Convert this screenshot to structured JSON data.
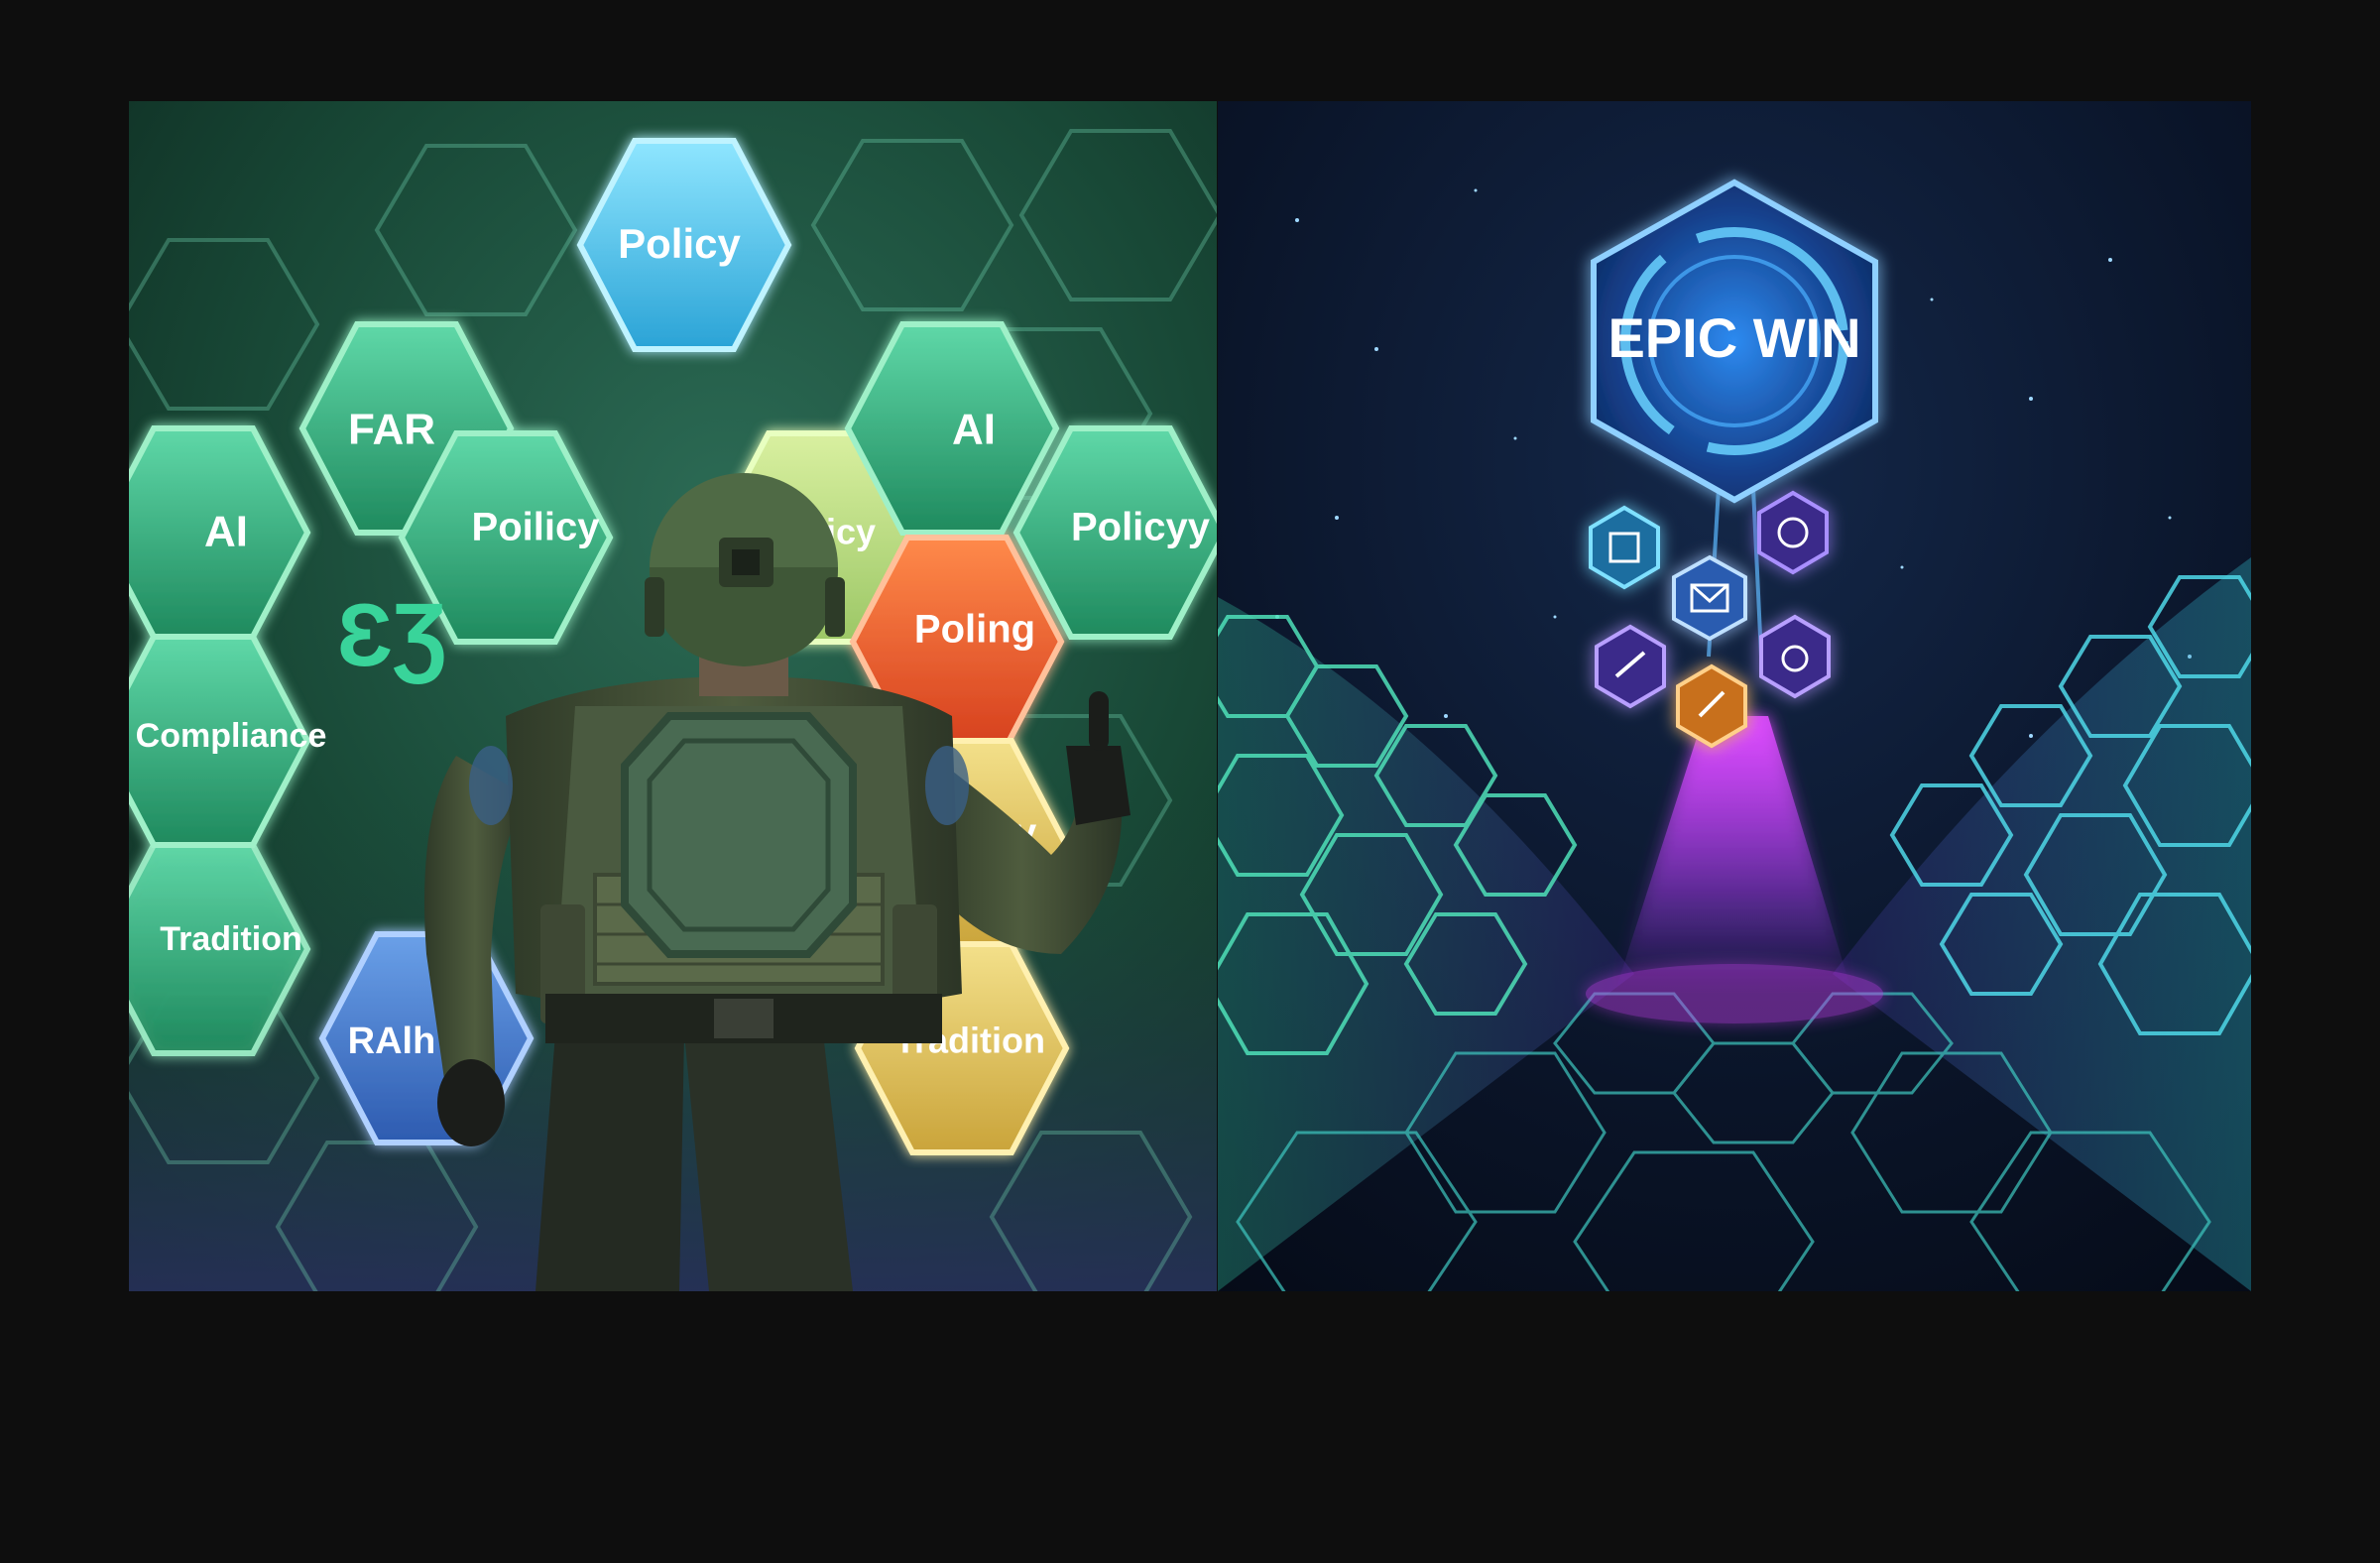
{
  "colors": {
    "background": "#0e0e0e",
    "hex_green": "#2fb07a",
    "hex_cyan": "#35b8e8",
    "hex_orange": "#e8582a",
    "hex_yellow": "#e3c04e",
    "hex_blue": "#3a6ec8",
    "glow_purple": "#c23ee8",
    "glow_cyan": "#4ad8d8",
    "badge_blue": "#2f7de0"
  },
  "left_panel": {
    "hex_labels": {
      "policy_top": "Policy",
      "far": "FAR",
      "ai_left": "AI",
      "policy_mid": "Poilicy",
      "policy_partial": "olicy",
      "ai_right": "AI",
      "policy_right": "Policyy",
      "glyph": "ƐƷ",
      "compliance": "Compliance",
      "poling": "Poling",
      "sy_partial": "sy",
      "tradition_left": "Tradition",
      "ralh": "RAlh",
      "tradition_right": "Tradition"
    }
  },
  "right_panel": {
    "badge_text": "EPIC WIN",
    "icons": [
      "cube-icon",
      "gear-icon",
      "envelope-icon",
      "tools-icon",
      "blob-icon",
      "slash-icon"
    ]
  }
}
